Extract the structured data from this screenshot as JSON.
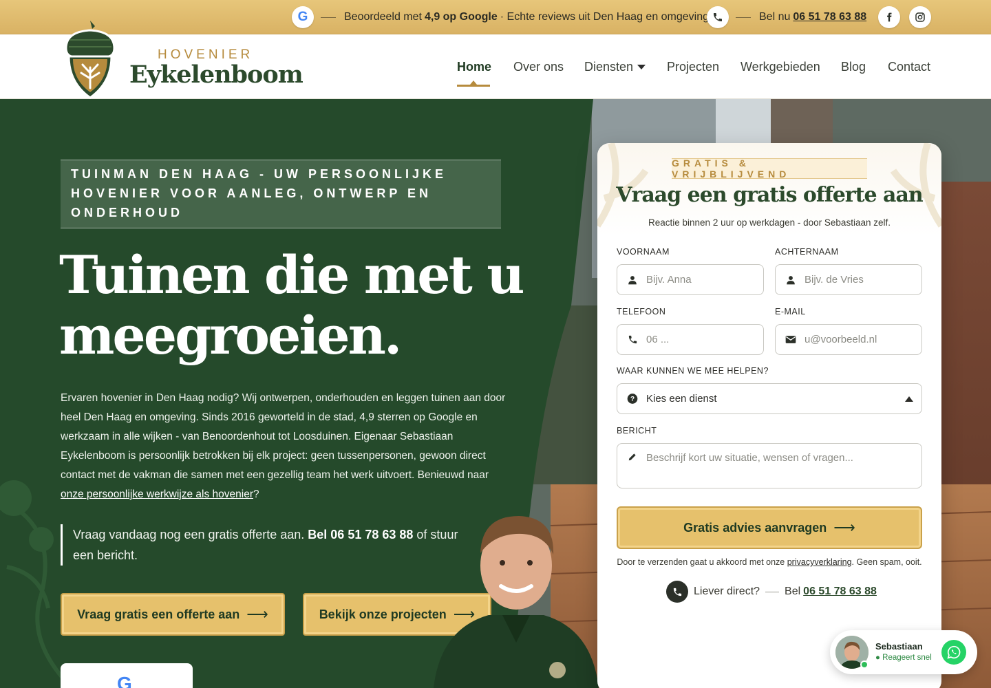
{
  "topbar": {
    "rating_prefix": "Beoordeeld met",
    "rating_value": "4,9 op Google",
    "rating_suffix": "· Echte reviews uit Den Haag en omgeving",
    "call_prefix": "Bel nu",
    "phone": "06 51 78 63 88",
    "icons": [
      "google-icon",
      "phone-icon",
      "facebook-icon",
      "instagram-icon"
    ]
  },
  "brand": {
    "top": "HOVENIER",
    "name": "Eykelenboom"
  },
  "nav": {
    "items": [
      {
        "label": "Home",
        "active": true
      },
      {
        "label": "Over ons"
      },
      {
        "label": "Diensten",
        "has_dropdown": true
      },
      {
        "label": "Projecten"
      },
      {
        "label": "Werkgebieden"
      },
      {
        "label": "Blog"
      },
      {
        "label": "Contact"
      }
    ]
  },
  "hero": {
    "eyebrow": "TUINMAN DEN HAAG - UW PERSOONLIJKE HOVENIER VOOR AANLEG, ONTWERP EN ONDERHOUD",
    "title_line1": "Tuinen die met u",
    "title_line2": "meegroeien.",
    "description": "Ervaren hovenier in Den Haag nodig? Wij ontwerpen, onderhouden en leggen tuinen aan door heel Den Haag en omgeving. Sinds 2016 geworteld in de stad, 4,9 sterren op Google en werkzaam in alle wijken - van Benoordenhout tot Loosduinen. Eigenaar Sebastiaan Eykelenboom is persoonlijk betrokken bij elk project: geen tussenpersonen, gewoon direct contact met de vakman die samen met een gezellig team het werk uitvoert. Benieuwd naar",
    "description_link": "onze persoonlijke werkwijze als hovenier",
    "description_end": "?",
    "quote_prefix": "Vraag vandaag nog een gratis offerte aan.",
    "quote_strong": "Bel 06 51 78 63 88",
    "quote_suffix": "of stuur een bericht.",
    "btn_primary": "Vraag gratis een offerte aan",
    "btn_secondary": "Bekijk onze projecten"
  },
  "form": {
    "badge": "GRATIS & VRIJBLIJVEND",
    "title": "Vraag een gratis offerte aan",
    "subtitle": "Reactie binnen 2 uur op werkdagen - door Sebastiaan zelf.",
    "first_name_label": "VOORNAAM",
    "first_name_placeholder": "Bijv. Anna",
    "last_name_label": "ACHTERNAAM",
    "last_name_placeholder": "Bijv. de Vries",
    "phone_label": "TELEFOON",
    "phone_placeholder": "06 ...",
    "email_label": "E-MAIL",
    "email_placeholder": "u@voorbeeld.nl",
    "service_label": "WAAR KUNNEN WE MEE HELPEN?",
    "service_value": "Kies een dienst",
    "message_label": "BERICHT",
    "message_placeholder": "Beschrijf kort uw situatie, wensen of vragen...",
    "submit": "Gratis advies aanvragen",
    "privacy_prefix": "Door te verzenden gaat u akkoord met onze",
    "privacy_link": "privacyverklaring",
    "privacy_suffix": ". Geen spam, ooit.",
    "direct_label": "Liever direct?",
    "direct_call": "Bel",
    "direct_phone": "06 51 78 63 88"
  },
  "chat": {
    "name": "Sebastiaan",
    "status": "Reageert snel"
  },
  "colors": {
    "green_dark": "#254a2b",
    "gold": "#e6c16c",
    "gold_text": "#b68b3d"
  }
}
